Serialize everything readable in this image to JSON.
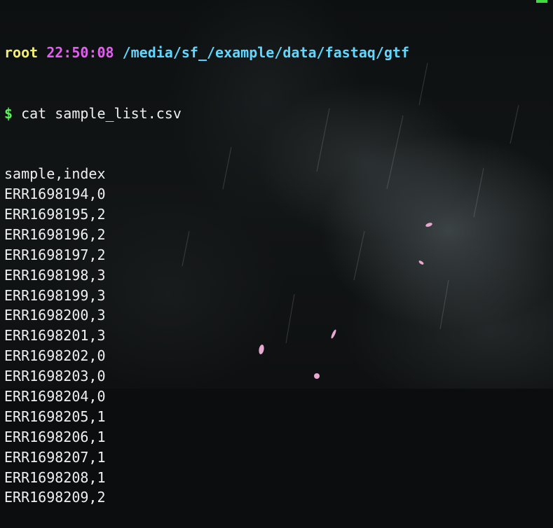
{
  "prompt": {
    "user": "root",
    "time": "22:50:08",
    "path": "/media/sf_/example/data/fastaq/gtf",
    "symbol": "$",
    "command": "cat sample_list.csv"
  },
  "output": {
    "lines": [
      "sample,index",
      "ERR1698194,0",
      "ERR1698195,2",
      "ERR1698196,2",
      "ERR1698197,2",
      "ERR1698198,3",
      "ERR1698199,3",
      "ERR1698200,3",
      "ERR1698201,3",
      "ERR1698202,0",
      "ERR1698203,0",
      "ERR1698204,0",
      "ERR1698205,1",
      "ERR1698206,1",
      "ERR1698207,1",
      "ERR1698208,1",
      "ERR1698209,2"
    ]
  },
  "colors": {
    "user": "#f4ef73",
    "time": "#e25ff0",
    "path": "#5fd7ff",
    "dollar": "#5ff25f",
    "text": "#f0f0f0",
    "background": "#0b0d0e"
  }
}
